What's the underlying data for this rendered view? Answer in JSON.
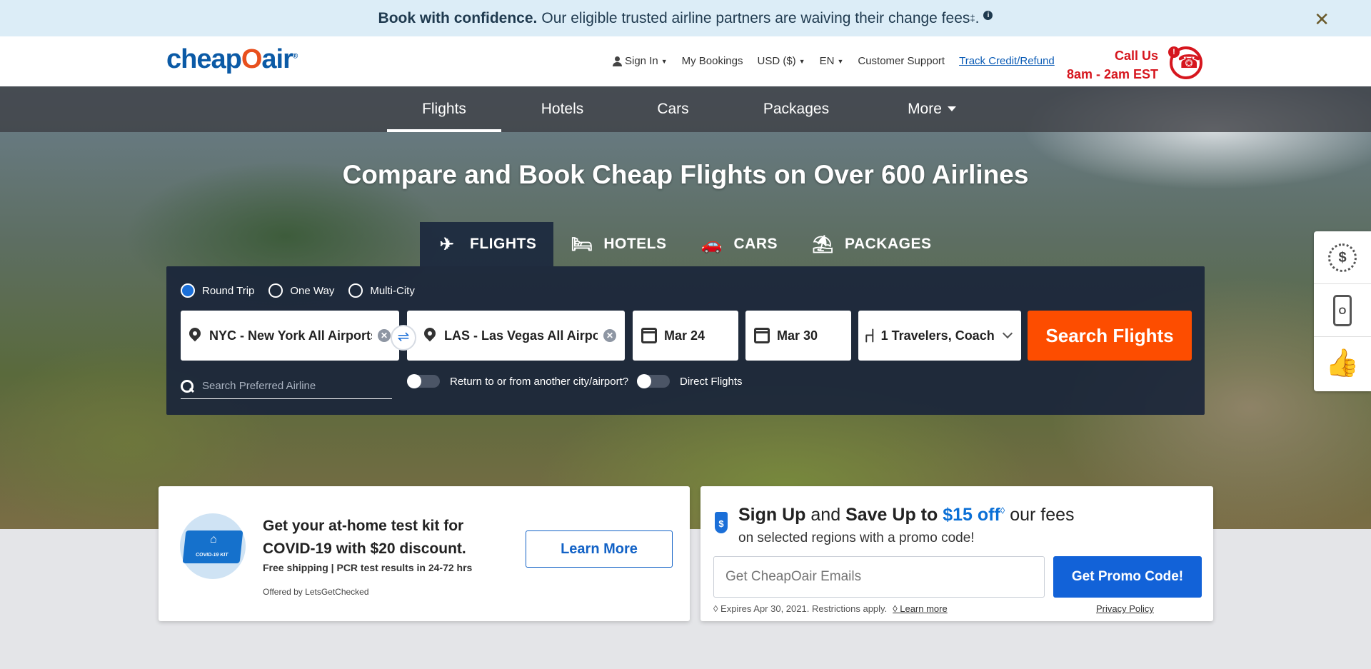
{
  "banner": {
    "bold": "Book with confidence.",
    "text": "Our eligible trusted airline partners are waiving their change fees",
    "sup": "‡",
    "period": ".",
    "info": "i",
    "close": "✕"
  },
  "header": {
    "logo_a": "cheap",
    "logo_o": "O",
    "logo_b": "air",
    "logo_reg": "®",
    "nav": {
      "sign_in": "Sign In",
      "my_bookings": "My Bookings",
      "currency": "USD ($)",
      "language": "EN",
      "support": "Customer Support",
      "track": "Track Credit/Refund"
    },
    "call_us": "Call Us",
    "hours": "8am - 2am EST"
  },
  "main_nav": [
    "Flights",
    "Hotels",
    "Cars",
    "Packages",
    "More"
  ],
  "hero_title": "Compare and Book Cheap Flights on Over 600 Airlines",
  "tabs": [
    {
      "label": "FLIGHTS",
      "icon": "airplane-icon"
    },
    {
      "label": "HOTELS",
      "icon": "bed-icon"
    },
    {
      "label": "CARS",
      "icon": "car-icon"
    },
    {
      "label": "PACKAGES",
      "icon": "beach-umbrella-icon"
    }
  ],
  "search": {
    "trip_types": [
      "Round Trip",
      "One Way",
      "Multi-City"
    ],
    "selected_trip_type": "Round Trip",
    "from": "NYC - New York All Airports",
    "to": "LAS - Las Vegas All Airports",
    "depart": "Mar 24",
    "return": "Mar 30",
    "travelers": "1 Travelers, Coach",
    "button": "Search Flights",
    "airline_placeholder": "Search Preferred Airline",
    "return_other": "Return to or from another city/airport?",
    "direct": "Direct Flights",
    "swap_symbol": "⇌",
    "clear_symbol": "✕"
  },
  "sidebar": {
    "badge_symbol": "$",
    "mobile_symbol": "O",
    "thumb_symbol": "👍"
  },
  "covid_card": {
    "kit_label": "COVID-19 KIT",
    "title": "Get your at-home test kit for COVID-19 with $20 discount.",
    "sub": "Free shipping | PCR test results in 24-72 hrs",
    "offered": "Offered by LetsGetChecked",
    "button": "Learn More"
  },
  "promo_card": {
    "tag_symbol": "$",
    "sign_up": "Sign Up",
    "and_save": "and",
    "save_up_to": "Save Up to",
    "amount": "$15 off",
    "diamond": "◊",
    "our_fees": "our fees",
    "sub": "on selected regions with a promo code!",
    "email_placeholder": "Get CheapOair Emails",
    "button": "Get Promo Code!",
    "expires": "◊ Expires Apr 30, 2021. Restrictions apply.",
    "learn_more": "◊ Learn more",
    "privacy": "Privacy Policy"
  },
  "colors": {
    "accent_orange": "#fd4d00",
    "brand_blue": "#0b5aa6",
    "call_red": "#d6161e"
  }
}
